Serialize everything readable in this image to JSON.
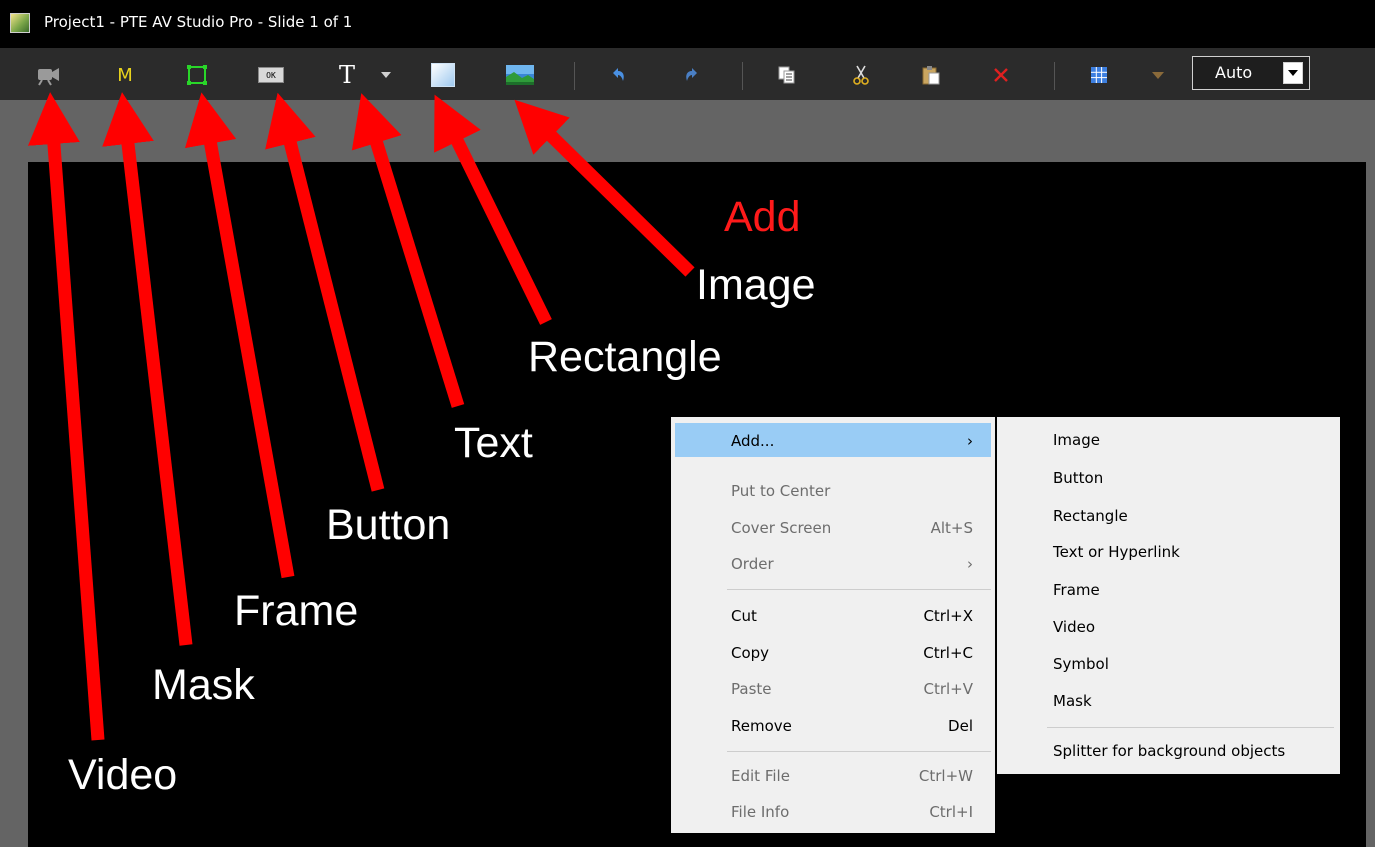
{
  "window": {
    "title": "Project1 - PTE AV Studio Pro - Slide 1 of 1"
  },
  "toolbar": {
    "mask_letter": "M",
    "button_icon_text": "OK",
    "text_letter": "T",
    "zoom_value": "Auto",
    "colors": {
      "mask": "#e8d21d",
      "frame": "#29d629",
      "undo": "#4a90e2",
      "redo": "#4a7fc4",
      "remove": "#e02020",
      "grid": "#3d7fe0",
      "grid_arrow": "#8a6a3a"
    }
  },
  "annotations": {
    "add": "Add",
    "image": "Image",
    "rectangle": "Rectangle",
    "text": "Text",
    "button": "Button",
    "frame": "Frame",
    "mask": "Mask",
    "video": "Video",
    "arrow_color": "#ff0000"
  },
  "context_menu": {
    "add": {
      "label": "Add...",
      "arrow": "›"
    },
    "put_to_center": {
      "label": "Put to Center"
    },
    "cover_screen": {
      "label": "Cover Screen",
      "shortcut": "Alt+S"
    },
    "order": {
      "label": "Order",
      "arrow": "›"
    },
    "cut": {
      "label": "Cut",
      "shortcut": "Ctrl+X"
    },
    "copy": {
      "label": "Copy",
      "shortcut": "Ctrl+C"
    },
    "paste": {
      "label": "Paste",
      "shortcut": "Ctrl+V"
    },
    "remove": {
      "label": "Remove",
      "shortcut": "Del"
    },
    "edit_file": {
      "label": "Edit File",
      "shortcut": "Ctrl+W"
    },
    "file_info": {
      "label": "File Info",
      "shortcut": "Ctrl+I"
    }
  },
  "submenu": {
    "image": "Image",
    "button": "Button",
    "rectangle": "Rectangle",
    "text_or_hyperlink": "Text or Hyperlink",
    "frame": "Frame",
    "video": "Video",
    "symbol": "Symbol",
    "mask": "Mask",
    "splitter": "Splitter for background objects"
  }
}
